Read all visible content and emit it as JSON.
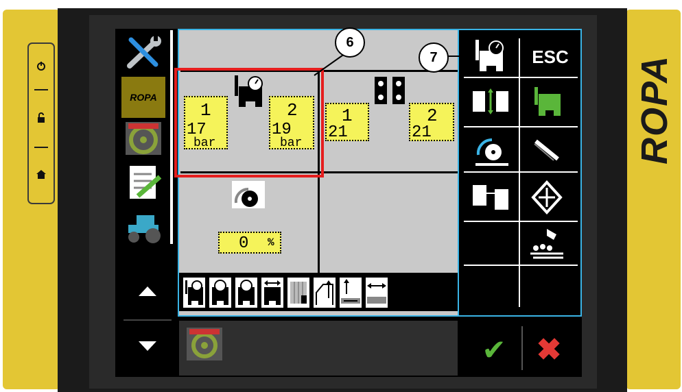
{
  "device": {
    "brand": "ROPA",
    "hw_buttons": [
      "power-icon",
      "unlock-icon",
      "home-icon"
    ]
  },
  "left_sidebar": {
    "items": [
      "tools-icon",
      "ropa-logo",
      "steering-wheel-icon",
      "checklist-edit-icon",
      "tractor-icon"
    ],
    "logo_text": "ROPA"
  },
  "header_band": {},
  "cell_top_left": {
    "icon": "pressure-gauge-icon",
    "left": {
      "index": "1",
      "value": "17",
      "unit": "bar"
    },
    "right": {
      "index": "2",
      "value": "19",
      "unit": "bar"
    }
  },
  "cell_top_right": {
    "icon": "twin-wheels-icon",
    "left": {
      "index": "1",
      "value": "21"
    },
    "right": {
      "index": "2",
      "value": "21"
    }
  },
  "cell_bottom_left": {
    "icon": "speed-dial-icon",
    "value": "0",
    "unit": "%"
  },
  "bottom_toolbar": {
    "icons": [
      "gauge-press-icon",
      "gauge-dial-a-icon",
      "gauge-dial-b-icon",
      "grid-chart-icon",
      "lift-arrows-icon",
      "track-up-icon",
      "track-width-icon"
    ]
  },
  "right_panel": {
    "esc_label": "ESC",
    "icons": [
      "pressure-gauge-icon",
      "wheels-arrows-icon",
      "green-wheel-icon",
      "rotor-icon",
      "knife-icon",
      "wheels-pair-icon",
      "crops-icon",
      "harvest-conveyor-icon"
    ]
  },
  "bottom_bar": {
    "icon": "steering-wheel-icon",
    "ok": "✔",
    "cancel": "✖"
  },
  "callouts": {
    "a": "6",
    "b": "7"
  },
  "colors": {
    "accent_frame": "#3ab4e6",
    "highlight": "#e61e1e",
    "value_box": "#f5f35a",
    "bezel": "#e3c634"
  }
}
